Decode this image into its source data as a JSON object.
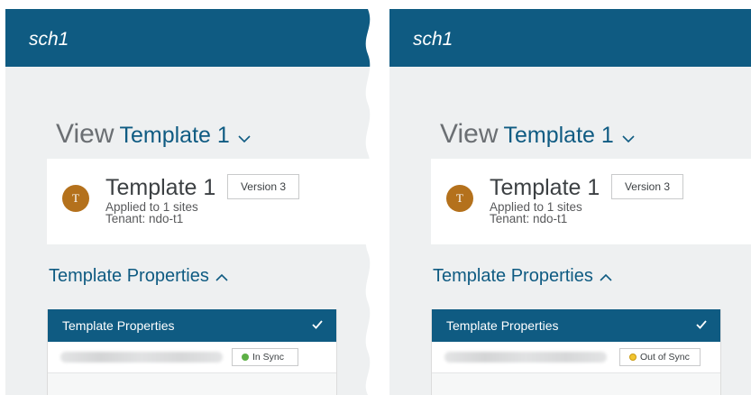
{
  "left": {
    "header_title": "sch1",
    "view_label": "View",
    "view_template": "Template 1",
    "card": {
      "avatar_letter": "T",
      "title": "Template 1",
      "applied": "Applied to 1 sites",
      "tenant": "Tenant: ndo-t1",
      "version": "Version 3"
    },
    "properties_link": "Template Properties",
    "dropdown": {
      "header": "Template Properties",
      "status": "In Sync",
      "status_color": "#5db046"
    }
  },
  "right": {
    "header_title": "sch1",
    "view_label": "View",
    "view_template": "Template 1",
    "card": {
      "avatar_letter": "T",
      "title": "Template 1",
      "applied": "Applied to 1 sites",
      "tenant": "Tenant: ndo-t1",
      "version": "Version 3"
    },
    "properties_link": "Template Properties",
    "dropdown": {
      "header": "Template Properties",
      "status": "Out of Sync",
      "status_color": "#f2c530"
    }
  },
  "colors": {
    "brand": "#0f5b82",
    "avatar": "#b4711c",
    "page_bg": "#eef0f1"
  }
}
